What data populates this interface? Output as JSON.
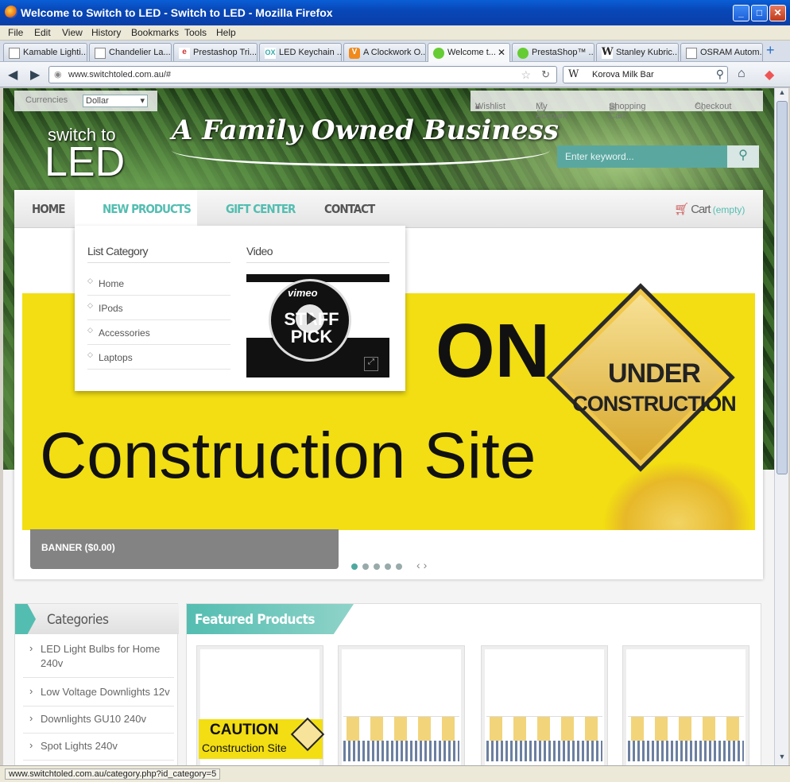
{
  "window": {
    "title": "Welcome to Switch to LED - Switch to LED - Mozilla Firefox",
    "buttons": [
      "_",
      "□",
      "✕"
    ]
  },
  "menu": [
    "File",
    "Edit",
    "View",
    "History",
    "Bookmarks",
    "Tools",
    "Help"
  ],
  "tabs": [
    {
      "label": "Kamable Lighti...",
      "icon": "page-icon"
    },
    {
      "label": "Chandelier La...",
      "icon": "page-icon"
    },
    {
      "label": "Prestashop Tri...",
      "icon": "ie-icon"
    },
    {
      "label": "LED Keychain ...",
      "icon": "ox-icon"
    },
    {
      "label": "A Clockwork O...",
      "icon": "v-icon"
    },
    {
      "label": "Welcome t...",
      "icon": "prestashop-icon",
      "active": true
    },
    {
      "label": "PrestaShop™ ...",
      "icon": "prestashop-icon"
    },
    {
      "label": "Stanley Kubric...",
      "icon": "wikipedia-icon"
    },
    {
      "label": "OSRAM Autom...",
      "icon": "page-icon"
    }
  ],
  "nav": {
    "url": "www.switchtoled.com.au/#",
    "search_engine": "W",
    "search_value": "Korova Milk Bar"
  },
  "site": {
    "currencies_label": "Currencies",
    "currency_value": "Dollar",
    "user_links": [
      "Wishlist",
      "My Account",
      "Shopping Cart",
      "Checkout"
    ],
    "logo_line1": "switch to",
    "logo_line2": "LED",
    "slogan": "A Family Owned Business",
    "keyword_placeholder": "Enter keyword...",
    "main_menu": [
      "HOME",
      "NEW PRODUCTS",
      "GIFT CENTER",
      "CONTACT"
    ],
    "cart_label": "Cart",
    "cart_state": "(empty)"
  },
  "dropdown": {
    "category_heading": "List Category",
    "video_heading": "Video",
    "categories": [
      "Home",
      "IPods",
      "Accessories",
      "Laptops"
    ],
    "video_brand": "vimeo",
    "video_badge": "STAFF PICK"
  },
  "banner": {
    "word_top": "ON",
    "word_bottom": "Construction Site",
    "sign_line1": "UNDER",
    "sign_line2": "CONSTRUCTION",
    "caption": "BANNER ($0.00)",
    "slide_count": 5,
    "active_slide": 1
  },
  "sidebar": {
    "heading": "Categories",
    "items": [
      "LED Light Bulbs for Home 240v",
      "Low Voltage Downlights 12v",
      "Downlights GU10 240v",
      "Spot Lights 240v"
    ]
  },
  "featured": {
    "heading": "Featured Products",
    "caution_title": "CAUTION",
    "caution_sub": "Construction Site"
  },
  "status_text": "www.switchtoled.com.au/category.php?id_category=5"
}
